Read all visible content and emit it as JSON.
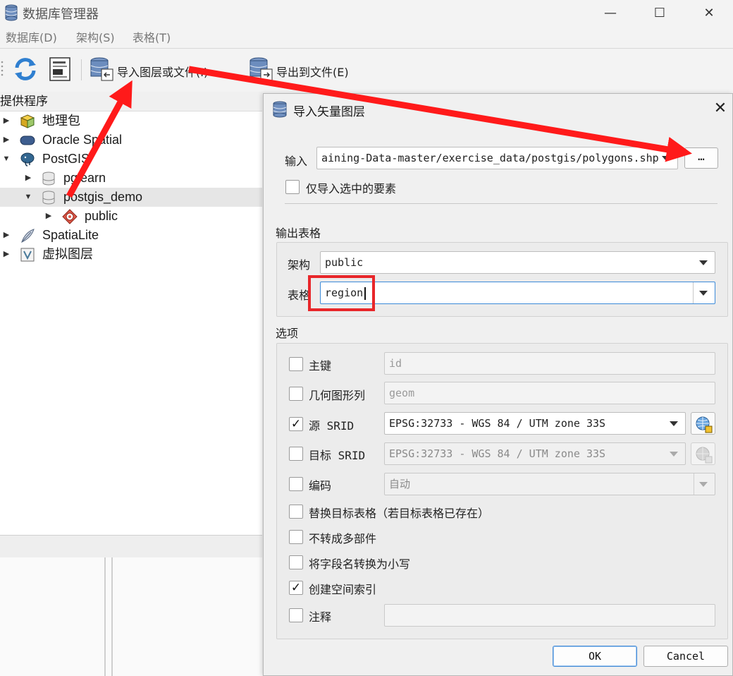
{
  "main": {
    "title": "数据库管理器",
    "window_controls": {
      "minimize": "—",
      "maximize": "☐",
      "close": "✕"
    },
    "menu": [
      "数据库(D)",
      "架构(S)",
      "表格(T)"
    ],
    "toolbar": {
      "import_label": "导入图层或文件(I)",
      "export_label": "导出到文件(E)"
    },
    "tree_header": "提供程序",
    "tree": [
      {
        "label": "地理包",
        "arrow": "▶",
        "icon": "geopackage-icon"
      },
      {
        "label": "Oracle Spatial",
        "arrow": "▶",
        "icon": "oracle-icon"
      },
      {
        "label": "PostGIS",
        "arrow": "▼",
        "icon": "postgis-elephant-icon"
      },
      {
        "label": "pglearn",
        "arrow": "▶",
        "icon": "database-icon"
      },
      {
        "label": "postgis_demo",
        "arrow": "▼",
        "icon": "database-icon"
      },
      {
        "label": "public",
        "arrow": "▶",
        "icon": "schema-icon"
      },
      {
        "label": "SpatiaLite",
        "arrow": "▶",
        "icon": "spatialite-feather-icon"
      },
      {
        "label": "虚拟图层",
        "arrow": "▶",
        "icon": "virtual-layer-icon"
      }
    ]
  },
  "dialog": {
    "title": "导入矢量图层",
    "close": "✕",
    "input_label": "输入",
    "input_value": "aining-Data-master/exercise_data/postgis/polygons.shp",
    "browse_label": "…",
    "only_selected_label": "仅导入选中的要素",
    "output_group": "输出表格",
    "schema_label": "架构",
    "schema_value": "public",
    "table_label": "表格",
    "table_value": "region",
    "options_group": "选项",
    "options": {
      "primary_key": {
        "label": "主键",
        "checked": false,
        "value": "id"
      },
      "geometry_column": {
        "label": "几何图形列",
        "checked": false,
        "value": "geom"
      },
      "source_srid": {
        "label": "源 SRID",
        "checked": true,
        "value": "EPSG:32733 - WGS 84 / UTM zone 33S"
      },
      "target_srid": {
        "label": "目标 SRID",
        "checked": false,
        "value": "EPSG:32733 - WGS 84 / UTM zone 33S"
      },
      "encoding": {
        "label": "编码",
        "checked": false,
        "value": "自动"
      },
      "replace_table": {
        "label": "替换目标表格（若目标表格已存在）",
        "checked": false
      },
      "no_multi": {
        "label": "不转成多部件",
        "checked": false
      },
      "lowercase": {
        "label": "将字段名转换为小写",
        "checked": false
      },
      "spatial_index": {
        "label": "创建空间索引",
        "checked": true
      },
      "comment": {
        "label": "注释",
        "checked": false,
        "value": ""
      }
    },
    "check_mark": "✓",
    "ok_label": "OK",
    "cancel_label": "Cancel"
  },
  "annotation_colors": {
    "arrow": "#ff1a1a",
    "highlight_box": "#e8262a"
  }
}
